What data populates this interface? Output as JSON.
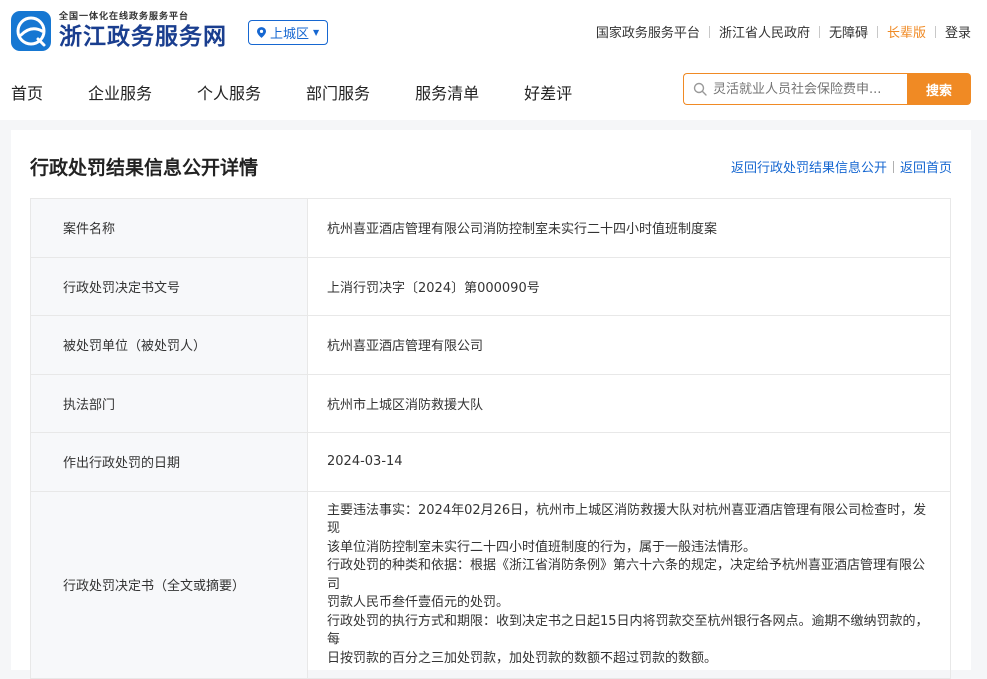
{
  "header": {
    "logo_small": "全国一体化在线政务服务平台",
    "logo_big": "浙江政务服务网",
    "region": "上城区",
    "links": [
      "国家政务服务平台",
      "浙江省人民政府",
      "无障碍",
      "长辈版",
      "登录"
    ]
  },
  "nav": {
    "items": [
      "首页",
      "企业服务",
      "个人服务",
      "部门服务",
      "服务清单",
      "好差评"
    ]
  },
  "search": {
    "placeholder": "灵活就业人员社会保险费申...",
    "button": "搜索"
  },
  "detail": {
    "title": "行政处罚结果信息公开详情",
    "back_list": "返回行政处罚结果信息公开",
    "back_home": "返回首页",
    "rows": [
      {
        "key": "案件名称",
        "value": "杭州喜亚酒店管理有限公司消防控制室未实行二十四小时值班制度案"
      },
      {
        "key": "行政处罚决定书文号",
        "value": "上消行罚决字〔2024〕第000090号"
      },
      {
        "key": "被处罚单位（被处罚人）",
        "value": "杭州喜亚酒店管理有限公司"
      },
      {
        "key": "执法部门",
        "value": "杭州市上城区消防救援大队"
      },
      {
        "key": "作出行政处罚的日期",
        "value": "2024-03-14"
      },
      {
        "key": "行政处罚决定书（全文或摘要）",
        "value_lines": [
          "主要违法事实：2024年02月26日，杭州市上城区消防救援大队对杭州喜亚酒店管理有限公司检查时，发现",
          "该单位消防控制室未实行二十四小时值班制度的行为，属于一般违法情形。",
          "行政处罚的种类和依据：根据《浙江省消防条例》第六十六条的规定，决定给予杭州喜亚酒店管理有限公司",
          "罚款人民币叁仟壹佰元的处罚。",
          "行政处罚的执行方式和期限：收到决定书之日起15日内将罚款交至杭州银行各网点。逾期不缴纳罚款的，每",
          "日按罚款的百分之三加处罚款，加处罚款的数额不超过罚款的数额。"
        ]
      }
    ]
  },
  "colors": {
    "brand_blue": "#1667d1",
    "accent_orange": "#f08a24"
  }
}
